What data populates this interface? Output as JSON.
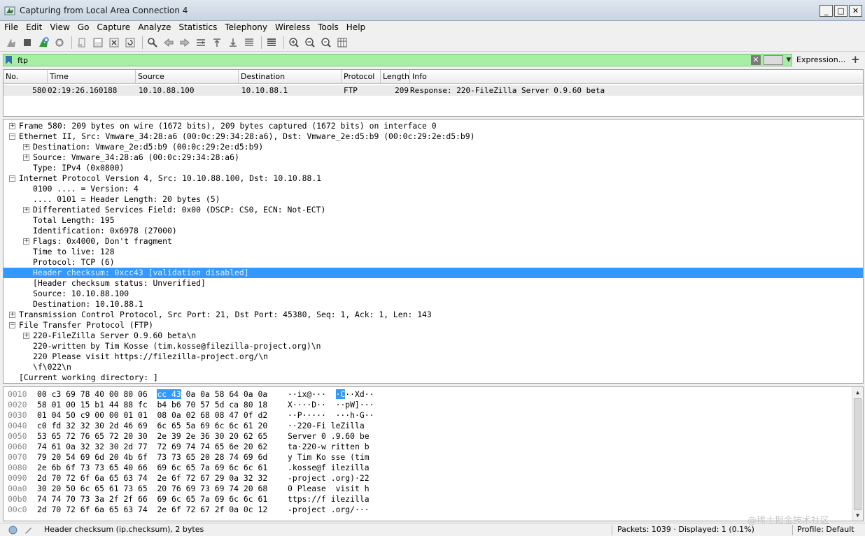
{
  "window": {
    "title": "Capturing from Local Area Connection 4",
    "minimize": "_",
    "maximize": "□",
    "close": "✕"
  },
  "menu": [
    "File",
    "Edit",
    "View",
    "Go",
    "Capture",
    "Analyze",
    "Statistics",
    "Telephony",
    "Wireless",
    "Tools",
    "Help"
  ],
  "toolbar": {
    "icons": [
      "shark-fin-start-icon",
      "stop-capture-icon",
      "restart-capture-icon",
      "capture-options-icon",
      "open-file-icon",
      "save-file-icon",
      "close-file-icon",
      "reload-file-icon",
      "find-packet-icon",
      "go-back-icon",
      "go-forward-icon",
      "go-to-packet-icon",
      "first-packet-icon",
      "last-packet-icon",
      "autoscroll-icon",
      "colorize-icon",
      "zoom-in-icon",
      "zoom-out-icon",
      "normal-size-icon",
      "resize-columns-icon"
    ]
  },
  "filter": {
    "value": "ftp",
    "clear": "✕",
    "dropdown": "▼",
    "expression_label": "Expression...",
    "plus": "+"
  },
  "packet_list": {
    "columns": [
      "No.",
      "Time",
      "Source",
      "Destination",
      "Protocol",
      "Length",
      "Info"
    ],
    "rows": [
      {
        "no": "580",
        "time": "02:19:26.160188",
        "source": "10.10.88.100",
        "destination": "10.10.88.1",
        "protocol": "FTP",
        "length": "209",
        "info": "Response: 220-FileZilla Server 0.9.60 beta"
      }
    ]
  },
  "details": [
    {
      "text": "Frame 580: 209 bytes on wire (1672 bits), 209 bytes captured (1672 bits) on interface 0",
      "level": 0,
      "expander": "+"
    },
    {
      "text": "Ethernet II, Src: Vmware_34:28:a6 (00:0c:29:34:28:a6), Dst: Vmware_2e:d5:b9 (00:0c:29:2e:d5:b9)",
      "level": 0,
      "expander": "−"
    },
    {
      "text": "Destination: Vmware_2e:d5:b9 (00:0c:29:2e:d5:b9)",
      "level": 1,
      "expander": "+"
    },
    {
      "text": "Source: Vmware_34:28:a6 (00:0c:29:34:28:a6)",
      "level": 1,
      "expander": "+"
    },
    {
      "text": "Type: IPv4 (0x0800)",
      "level": 1,
      "expander": ""
    },
    {
      "text": "Internet Protocol Version 4, Src: 10.10.88.100, Dst: 10.10.88.1",
      "level": 0,
      "expander": "−"
    },
    {
      "text": "0100 .... = Version: 4",
      "level": 1,
      "expander": ""
    },
    {
      "text": ".... 0101 = Header Length: 20 bytes (5)",
      "level": 1,
      "expander": ""
    },
    {
      "text": "Differentiated Services Field: 0x00 (DSCP: CS0, ECN: Not-ECT)",
      "level": 1,
      "expander": "+"
    },
    {
      "text": "Total Length: 195",
      "level": 1,
      "expander": ""
    },
    {
      "text": "Identification: 0x6978 (27000)",
      "level": 1,
      "expander": ""
    },
    {
      "text": "Flags: 0x4000, Don't fragment",
      "level": 1,
      "expander": "+"
    },
    {
      "text": "Time to live: 128",
      "level": 1,
      "expander": ""
    },
    {
      "text": "Protocol: TCP (6)",
      "level": 1,
      "expander": ""
    },
    {
      "text": "Header checksum: 0xcc43 [validation disabled]",
      "level": 1,
      "expander": "",
      "selected": true
    },
    {
      "text": "[Header checksum status: Unverified]",
      "level": 1,
      "expander": ""
    },
    {
      "text": "Source: 10.10.88.100",
      "level": 1,
      "expander": ""
    },
    {
      "text": "Destination: 10.10.88.1",
      "level": 1,
      "expander": ""
    },
    {
      "text": "Transmission Control Protocol, Src Port: 21, Dst Port: 45380, Seq: 1, Ack: 1, Len: 143",
      "level": 0,
      "expander": "+"
    },
    {
      "text": "File Transfer Protocol (FTP)",
      "level": 0,
      "expander": "−"
    },
    {
      "text": "220-FileZilla Server 0.9.60 beta\\n",
      "level": 1,
      "expander": "+"
    },
    {
      "text": "220-written by Tim Kosse (tim.kosse@filezilla-project.org)\\n",
      "level": 1,
      "expander": ""
    },
    {
      "text": "220 Please visit https://filezilla-project.org/\\n",
      "level": 1,
      "expander": ""
    },
    {
      "text": "\\f\\022\\n",
      "level": 1,
      "expander": ""
    },
    {
      "text": "[Current working directory: ]",
      "level": 0,
      "expander": ""
    }
  ],
  "bytes": [
    {
      "offset": "0010",
      "hex_pre": "00 c3 69 78 40 00 80 06  ",
      "hex_hl": "cc 43",
      "hex_post": " 0a 0a 58 64 0a 0a",
      "ascii_pre": "··ix@···  ",
      "ascii_hl": "·C",
      "ascii_post": "··Xd··"
    },
    {
      "offset": "0020",
      "hex": "58 01 00 15 b1 44 88 fc  b4 b6 70 57 5d ca 80 18",
      "ascii": "X····D··  ··pW]···"
    },
    {
      "offset": "0030",
      "hex": "01 04 50 c9 00 00 01 01  08 0a 02 68 08 47 0f d2",
      "ascii": "··P·····  ···h·G··"
    },
    {
      "offset": "0040",
      "hex": "c0 fd 32 32 30 2d 46 69  6c 65 5a 69 6c 6c 61 20",
      "ascii": "··220-Fi leZilla "
    },
    {
      "offset": "0050",
      "hex": "53 65 72 76 65 72 20 30  2e 39 2e 36 30 20 62 65",
      "ascii": "Server 0 .9.60 be"
    },
    {
      "offset": "0060",
      "hex": "74 61 0a 32 32 30 2d 77  72 69 74 74 65 6e 20 62",
      "ascii": "ta·220-w ritten b"
    },
    {
      "offset": "0070",
      "hex": "79 20 54 69 6d 20 4b 6f  73 73 65 20 28 74 69 6d",
      "ascii": "y Tim Ko sse (tim"
    },
    {
      "offset": "0080",
      "hex": "2e 6b 6f 73 73 65 40 66  69 6c 65 7a 69 6c 6c 61",
      "ascii": ".kosse@f ilezilla"
    },
    {
      "offset": "0090",
      "hex": "2d 70 72 6f 6a 65 63 74  2e 6f 72 67 29 0a 32 32",
      "ascii": "-project .org)·22"
    },
    {
      "offset": "00a0",
      "hex": "30 20 50 6c 65 61 73 65  20 76 69 73 69 74 20 68",
      "ascii": "0 Please  visit h"
    },
    {
      "offset": "00b0",
      "hex": "74 74 70 73 3a 2f 2f 66  69 6c 65 7a 69 6c 6c 61",
      "ascii": "ttps://f ilezilla"
    },
    {
      "offset": "00c0",
      "hex": "2d 70 72 6f 6a 65 63 74  2e 6f 72 67 2f 0a 0c 12",
      "ascii": "-project .org/···"
    }
  ],
  "scroll": {
    "up": "▲",
    "down": "▼"
  },
  "status": {
    "field": "Header checksum (ip.checksum), 2 bytes",
    "packets": "Packets: 1039 · Displayed: 1 (0.1%)",
    "profile": "Profile: Default",
    "watermark": "@稀土掘金技术社区"
  },
  "colors": {
    "selection": "#3399ff",
    "filter_valid": "#a6f0a6"
  }
}
